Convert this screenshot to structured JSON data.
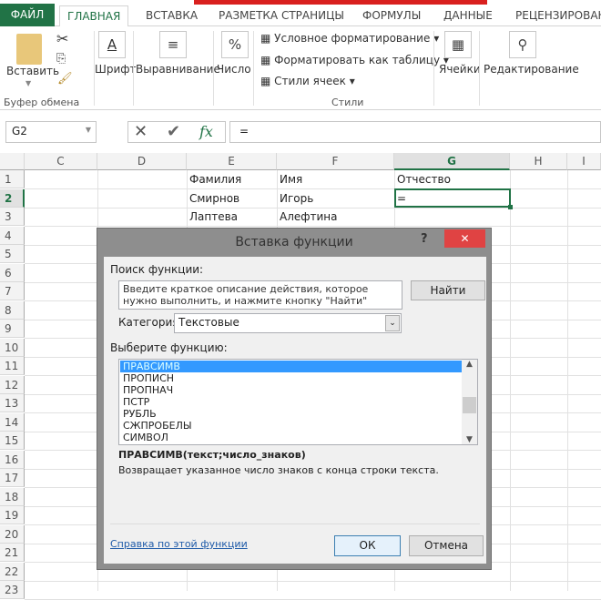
{
  "ribbon_tabs": [
    "ФАЙЛ",
    "ГЛАВНАЯ",
    "ВСТАВКА",
    "РАЗМЕТКА СТРАНИЦЫ",
    "ФОРМУЛЫ",
    "ДАННЫЕ",
    "РЕЦЕНЗИРОВАН"
  ],
  "ribbon": {
    "paste": "Вставить",
    "clipboard_group": "Буфер обмена",
    "font": "Шрифт",
    "alignment": "Выравнивание",
    "number": "Число",
    "conditional": "Условное форматирование",
    "format_table": "Форматировать как таблицу",
    "cell_styles": "Стили ячеек",
    "styles_group": "Стили",
    "cells": "Ячейки",
    "editing": "Редактирование"
  },
  "formula_bar": {
    "name_box": "G2",
    "fx": "fx",
    "value": "="
  },
  "columns": [
    "C",
    "D",
    "E",
    "F",
    "G",
    "H",
    "I"
  ],
  "rows": [
    "1",
    "2",
    "3",
    "4",
    "5",
    "6",
    "7",
    "8",
    "9",
    "10",
    "11",
    "12",
    "13",
    "14",
    "15",
    "16",
    "17",
    "18",
    "19",
    "20",
    "21",
    "22",
    "23"
  ],
  "cells": {
    "E1": "Фамилия",
    "F1": "Имя",
    "G1": "Отчество",
    "E2": "Смирнов",
    "F2": "Игорь",
    "G2": "=",
    "E3": "Лаптева",
    "F3": "Алефтина"
  },
  "dialog": {
    "title": "Вставка функции",
    "help": "?",
    "close": "✕",
    "search_label": "Поиск функции:",
    "search_text": "Введите краткое описание действия, которое нужно выполнить, и нажмите кнопку \"Найти\"",
    "find_button": "Найти",
    "category_label": "Категория:",
    "category_value": "Текстовые",
    "select_label": "Выберите функцию:",
    "functions": [
      "ПРАВСИМВ",
      "ПРОПИСН",
      "ПРОПНАЧ",
      "ПСТР",
      "РУБЛЬ",
      "СЖПРОБЕЛЫ",
      "СИМВОЛ"
    ],
    "selected_function": "ПРАВСИМВ",
    "signature": "ПРАВСИМВ(текст;число_знаков)",
    "description": "Возвращает указанное число знаков с конца строки текста.",
    "help_link": "Справка по этой функции",
    "ok": "ОК",
    "cancel": "Отмена"
  },
  "colors": {
    "accent": "#217346",
    "selection": "#3399ff",
    "close": "#e04343"
  }
}
